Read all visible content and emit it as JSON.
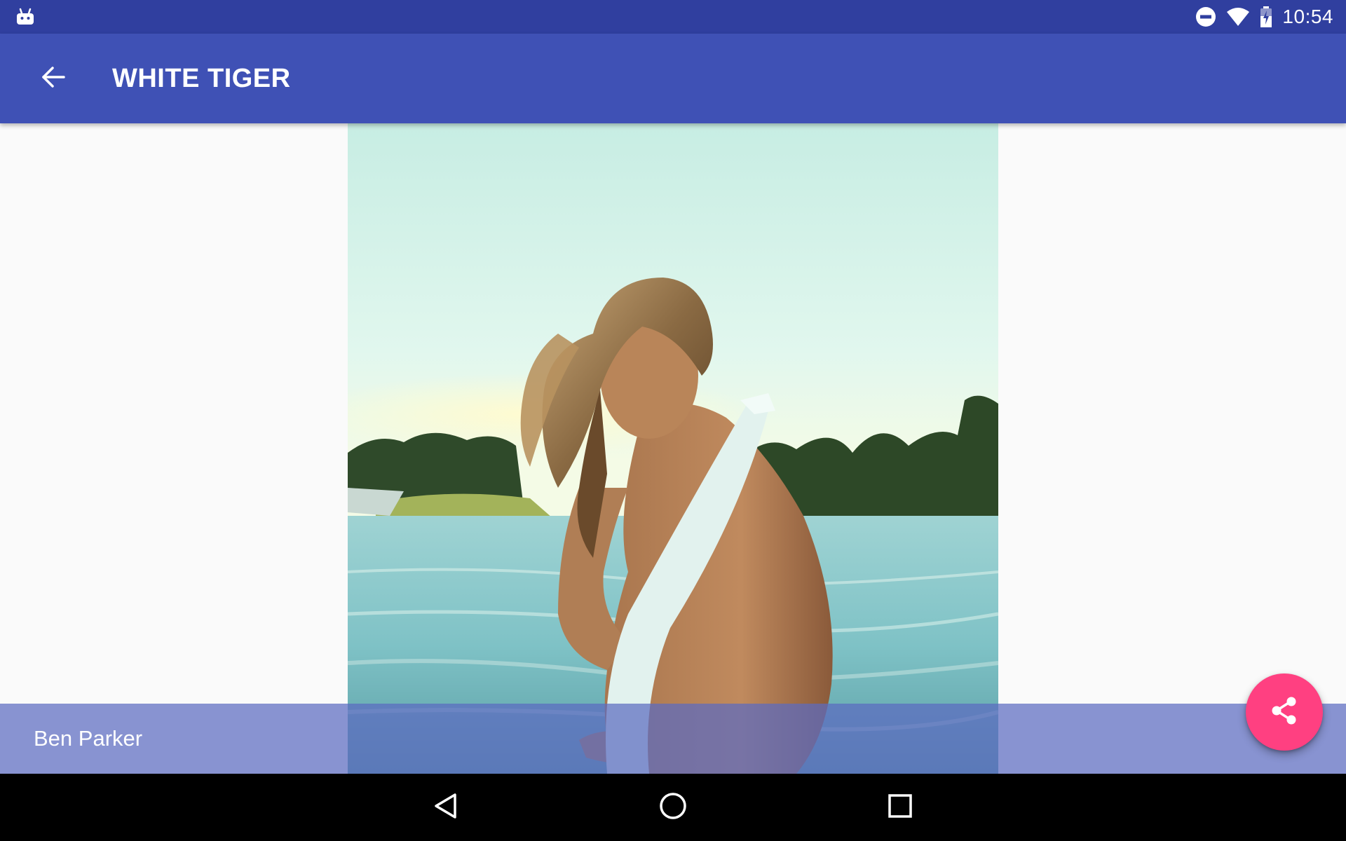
{
  "status_bar": {
    "time": "10:54",
    "icons": [
      "android-icon",
      "do-not-disturb-icon",
      "wifi-icon",
      "battery-charging-icon"
    ]
  },
  "app_bar": {
    "title": "WHITE TIGER",
    "back_icon": "arrow-back-icon"
  },
  "photo": {
    "subject": "photo"
  },
  "caption": {
    "author": "Ben Parker"
  },
  "fab": {
    "icon": "share-icon",
    "color": "#ff4081"
  },
  "nav_bar": {
    "icons": [
      "nav-back-icon",
      "nav-home-icon",
      "nav-recents-icon"
    ]
  },
  "colors": {
    "status_bar": "#303f9f",
    "primary": "#3f51b5",
    "caption_overlay": "#5c6bc0",
    "accent": "#ff4081"
  }
}
